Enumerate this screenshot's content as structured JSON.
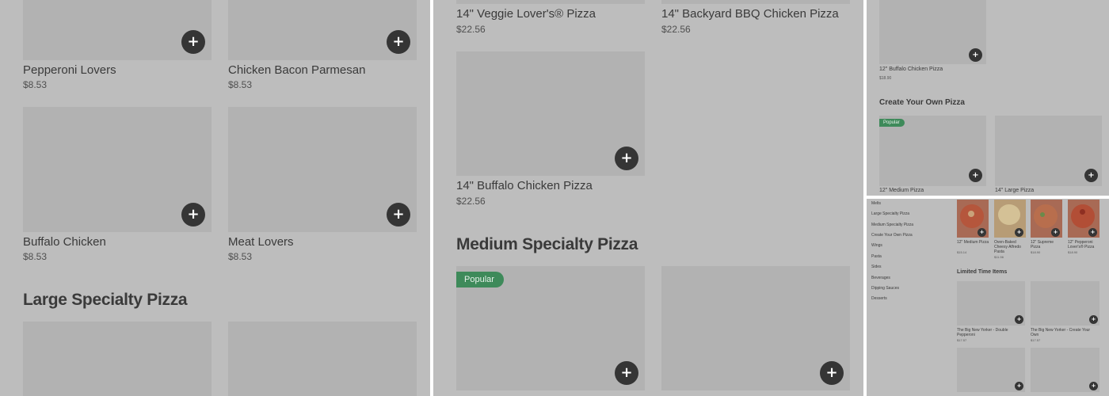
{
  "panel1": {
    "items": [
      {
        "name": "Pepperoni Lovers",
        "price": "$8.53"
      },
      {
        "name": "Chicken Bacon Parmesan",
        "price": "$8.53"
      },
      {
        "name": "Buffalo Chicken",
        "price": "$8.53"
      },
      {
        "name": "Meat Lovers",
        "price": "$8.53"
      }
    ],
    "section_heading": "Large Specialty Pizza"
  },
  "panel2": {
    "items": [
      {
        "name": "14\" Veggie Lover's® Pizza",
        "price": "$22.56"
      },
      {
        "name": "14\" Backyard BBQ Chicken Pizza",
        "price": "$22.56"
      },
      {
        "name": "14\" Buffalo Chicken Pizza",
        "price": "$22.56"
      }
    ],
    "section_heading": "Medium Specialty Pizza",
    "badge": "Popular"
  },
  "panel3": {
    "item": {
      "name": "12\" Buffalo Chicken Pizza",
      "price": "$18.90"
    },
    "section_heading": "Create Your Own Pizza",
    "badge": "Popular",
    "cards": [
      {
        "name": "12\" Medium Pizza"
      },
      {
        "name": "14\" Large Pizza"
      }
    ]
  },
  "panel4": {
    "nav": [
      "Melts",
      "Large Specialty Pizza",
      "Medium Specialty Pizza",
      "Create Your Own Pizza",
      "Wings",
      "Pasta",
      "Sides",
      "Beverages",
      "Dipping Sauces",
      "Desserts"
    ],
    "featured": [
      {
        "name": "12\" Medium Pizza",
        "price": "$15.14"
      },
      {
        "name": "Oven-Baked Cheesy Alfredo Pasta",
        "price": "$11.56"
      },
      {
        "name": "12\" Supreme Pizza",
        "price": "$18.90"
      },
      {
        "name": "12\" Pepperoni Lover's® Pizza",
        "price": "$18.90"
      }
    ],
    "section_heading": "Limited Time Items",
    "limited": [
      {
        "name": "The Big New Yorker - Double Pepperoni",
        "price": "$17.57"
      },
      {
        "name": "The Big New Yorker - Create Your Own",
        "price": "$17.57"
      }
    ]
  },
  "colors": {
    "overlay": "#bdbdbd",
    "card": "#b2b2b2",
    "add_button": "#353535",
    "badge": "#3e8a5a",
    "text": "#3a3a3a"
  },
  "icons": {
    "add": "plus-icon"
  }
}
